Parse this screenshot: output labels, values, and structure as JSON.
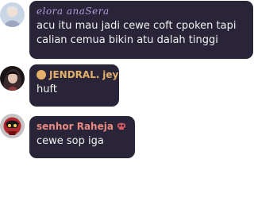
{
  "messages": [
    {
      "username": "elora anaSera",
      "text": "acu itu mau jadi cewe coft cpoken tapi calian cemua bikin atu dalah tinggi",
      "avatar_icon": "user-avatar-icon",
      "name_color": "#b19ad6"
    },
    {
      "username_prefix": "JENDRAL.",
      "username_suffix": "jey",
      "text": "huft",
      "avatar_icon": "user-avatar-icon",
      "badge_icon": "crown-badge-icon",
      "name_color": "#e3b16a"
    },
    {
      "username": "senhor Raheja",
      "text": "cewe sop iga",
      "avatar_icon": "user-avatar-icon",
      "decoration_icon": "skull-icon",
      "name_color": "#e98b82"
    }
  ],
  "colors": {
    "bubble_bg": "#2a2439",
    "text": "#f2f2f2"
  }
}
